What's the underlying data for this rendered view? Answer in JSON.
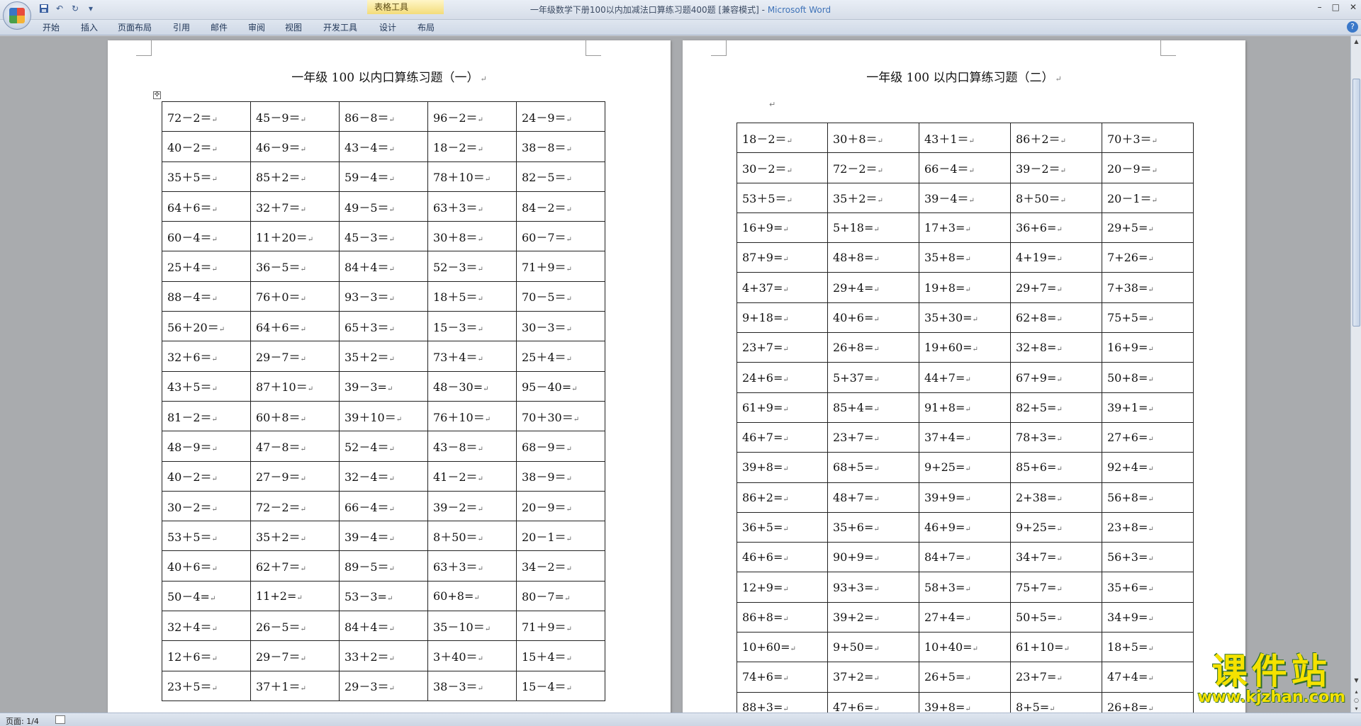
{
  "window": {
    "title": "一年级数学下册100以内加减法口算练习题400题 [兼容模式] - ",
    "app_name": "Microsoft Word",
    "context_tab": "表格工具"
  },
  "qat": {
    "save_icon": "save-icon",
    "undo_icon": "undo-icon",
    "redo_icon": "redo-icon",
    "customize": "▾"
  },
  "ribbon": {
    "tabs": [
      "开始",
      "插入",
      "页面布局",
      "引用",
      "邮件",
      "审阅",
      "视图",
      "开发工具",
      "设计",
      "布局"
    ],
    "help": "?"
  },
  "page1": {
    "title": "一年级 100 以内口算练习题（一）",
    "rows": [
      [
        "72－2＝",
        "45－9＝",
        "86－8＝",
        "96－2＝",
        "24－9＝"
      ],
      [
        "40－2＝",
        "46－9＝",
        "43－4＝",
        "18－2＝",
        "38－8＝"
      ],
      [
        "35＋5＝",
        "85＋2＝",
        "59－4＝",
        "78＋10＝",
        "82－5＝"
      ],
      [
        "64＋6＝",
        "32＋7＝",
        "49－5＝",
        "63＋3＝",
        "84－2＝"
      ],
      [
        "60－4＝",
        "11＋20＝",
        "45－3＝",
        "30＋8＝",
        "60－7＝"
      ],
      [
        "25＋4＝",
        "36－5＝",
        "84＋4＝",
        "52－3＝",
        "71＋9＝"
      ],
      [
        "88－4＝",
        "76＋0＝",
        "93－3＝",
        "18＋5＝",
        "70－5＝"
      ],
      [
        "56＋20＝",
        "64＋6＝",
        "65＋3＝",
        "15－3＝",
        "30－3＝"
      ],
      [
        "32＋6＝",
        "29－7＝",
        "35＋2＝",
        "73＋4＝",
        "25＋4＝"
      ],
      [
        "43＋5＝",
        "87＋10＝",
        "39－3=",
        "48－30=",
        "95－40="
      ],
      [
        "81－2＝",
        "60＋8＝",
        "39＋10＝",
        "76＋10＝",
        "70＋30＝"
      ],
      [
        "48－9＝",
        "47－8＝",
        "52－4＝",
        "43－8＝",
        "68－9＝"
      ],
      [
        "40－2＝",
        "27－9＝",
        "32－4＝",
        "41－2＝",
        "38－9＝"
      ],
      [
        "30－2＝",
        "72－2＝",
        "66－4＝",
        "39－2＝",
        "20－9＝"
      ],
      [
        "53＋5＝",
        "35＋2＝",
        "39－4＝",
        "8＋50＝",
        "20－1＝"
      ],
      [
        "40＋6＝",
        "62＋7＝",
        "89－5＝",
        "63＋3＝",
        "34－2＝"
      ],
      [
        "50－4=",
        "11+2=",
        "53－3=",
        "60+8=",
        "80－7="
      ],
      [
        "32＋4＝",
        "26－5＝",
        "84＋4＝",
        "35－10＝",
        "71＋9＝"
      ],
      [
        "12＋6＝",
        "29－7＝",
        "33＋2＝",
        "3＋40＝",
        "15＋4＝"
      ],
      [
        "23＋5＝",
        "37＋1＝",
        "29－3＝",
        "38－3＝",
        "15－4＝"
      ]
    ]
  },
  "page2": {
    "title": "一年级 100 以内口算练习题（二）",
    "rows": [
      [
        "18－2＝",
        "30＋8＝",
        "43＋1＝",
        "86＋2＝",
        "70＋3＝"
      ],
      [
        "30－2＝",
        "72－2＝",
        "66－4＝",
        "39－2＝",
        "20－9＝"
      ],
      [
        "53＋5＝",
        "35＋2＝",
        "39－4＝",
        "8＋50＝",
        "20－1＝"
      ],
      [
        "16+9=",
        "5+18=",
        "17+3=",
        "36+6=",
        "29+5="
      ],
      [
        "87+9=",
        "48+8=",
        "35+8=",
        "4+19=",
        "7+26="
      ],
      [
        "4+37=",
        "29+4=",
        "19+8=",
        "29+7=",
        "7+38="
      ],
      [
        "9+18=",
        "40+6=",
        "35+30=",
        "62+8=",
        "75+5="
      ],
      [
        "23+7=",
        "26+8=",
        "19+60=",
        "32+8=",
        "16+9="
      ],
      [
        "24+6=",
        "5+37=",
        "44+7=",
        "67+9=",
        "50+8="
      ],
      [
        "61+9=",
        "85+4=",
        "91+8=",
        "82+5=",
        "39+1="
      ],
      [
        "46+7=",
        "23+7=",
        "37+4=",
        "78+3=",
        "27+6="
      ],
      [
        "39+8=",
        "68+5=",
        "9+25=",
        "85+6=",
        "92+4="
      ],
      [
        "86+2=",
        "48+7=",
        "39+9=",
        "2+38=",
        "56+8="
      ],
      [
        "36+5=",
        "35+6=",
        "46+9=",
        "9+25=",
        "23+8="
      ],
      [
        "46+6=",
        "90+9=",
        "84+7=",
        "34+7=",
        "56+3="
      ],
      [
        "12+9=",
        "93+3=",
        "58+3=",
        "75+7=",
        "35+6="
      ],
      [
        "86+8=",
        "39+2=",
        "27+4=",
        "50+5=",
        "34+9="
      ],
      [
        "10+60=",
        "9+50=",
        "10+40=",
        "61+10=",
        "18+5="
      ],
      [
        "74+6=",
        "37+2=",
        "26+5=",
        "23+7=",
        "47+4="
      ],
      [
        "88+3=",
        "47+6=",
        "39+8=",
        "8+5=",
        "26+8="
      ]
    ]
  },
  "status": {
    "page": "页面: 1/4"
  },
  "watermark": {
    "big": "课件站",
    "small": "www.kjzhan.com"
  }
}
